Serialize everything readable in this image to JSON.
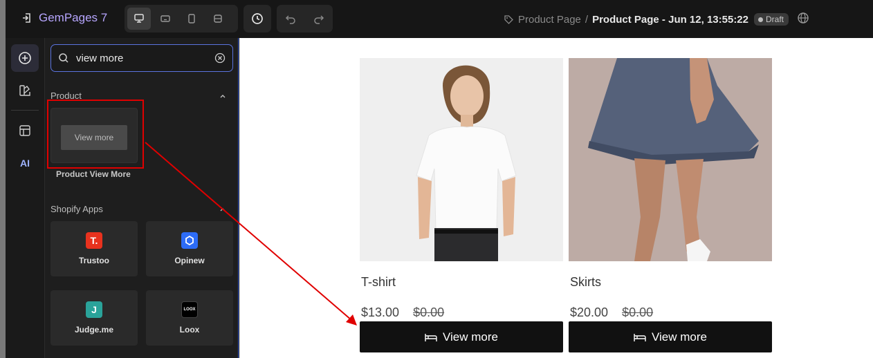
{
  "app": {
    "name": "GemPages 7"
  },
  "breadcrumb": {
    "parent": "Product Page",
    "separator": "/",
    "current": "Product Page - Jun 12, 13:55:22",
    "status": "Draft"
  },
  "toolbar": {
    "devices": [
      "desktop-icon",
      "tablet-landscape-icon",
      "mobile-icon",
      "responsive-icon"
    ],
    "active_device": "desktop-icon"
  },
  "rail": {
    "ai_label": "AI"
  },
  "search": {
    "value": "view more"
  },
  "sections": {
    "product": {
      "title": "Product",
      "item_preview_label": "View more",
      "item_label": "Product View More"
    },
    "shopify_apps": {
      "title": "Shopify Apps",
      "apps": [
        {
          "name": "Trustoo",
          "badge": "T.",
          "color": "#e8321e"
        },
        {
          "name": "Opinew",
          "badge": "C",
          "color": "#2d6cf6"
        },
        {
          "name": "Judge.me",
          "badge": "J",
          "color": "#2aa39a"
        },
        {
          "name": "Loox",
          "badge": "LOOX",
          "color": "#000000"
        }
      ]
    }
  },
  "products": [
    {
      "name": "T-shirt",
      "price": "$13.00",
      "compare_price": "$0.00",
      "button": "View more"
    },
    {
      "name": "Skirts",
      "price": "$20.00",
      "compare_price": "$0.00",
      "button": "View more"
    }
  ],
  "colors": {
    "accent": "#b7a6ff",
    "annotation": "#e00000",
    "panel_border": "#3456c8"
  }
}
